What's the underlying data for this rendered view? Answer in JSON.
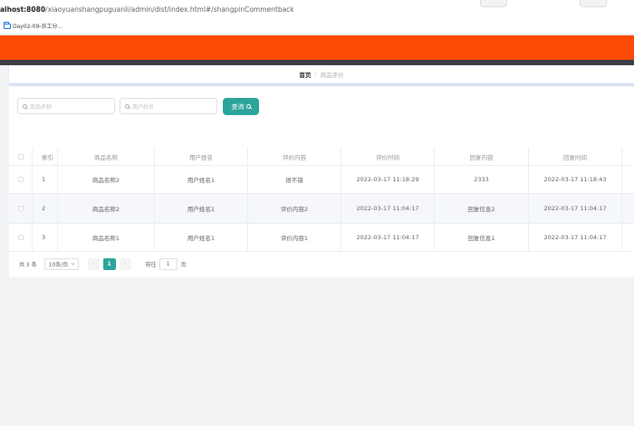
{
  "browser": {
    "url_host": "alhost:8080",
    "url_path": "/xiaoyuanshangpuguanli/admin/dist/index.html#/shangpinCommentback",
    "bookmark_label": "Day02-09-员工分..."
  },
  "colors": {
    "header": "#fc4a05",
    "accent": "#2ba59a"
  },
  "breadcrumb": {
    "home": "首页",
    "separator": "/",
    "current": "商品评价"
  },
  "search": {
    "product_placeholder": "商品名称",
    "user_placeholder": "用户姓名",
    "query_label": "查询"
  },
  "table": {
    "columns": [
      "索引",
      "商品名称",
      "用户姓名",
      "评价内容",
      "评价时间",
      "回复内容",
      "回复时间"
    ],
    "rows": [
      {
        "index": "1",
        "product": "商品名称2",
        "user": "用户姓名1",
        "content": "很不错",
        "time": "2022-03-17 11:18:29",
        "reply": "2333",
        "reply_time": "2022-03-17 11:18:43"
      },
      {
        "index": "2",
        "product": "商品名称2",
        "user": "用户姓名1",
        "content": "评价内容2",
        "time": "2022-03-17 11:04:17",
        "reply": "回复信息2",
        "reply_time": "2022-03-17 11:04:17"
      },
      {
        "index": "3",
        "product": "商品名称1",
        "user": "用户姓名1",
        "content": "评价内容1",
        "time": "2022-03-17 11:04:17",
        "reply": "回复信息1",
        "reply_time": "2022-03-17 11:04:17"
      }
    ]
  },
  "pagination": {
    "total": "共 3 条",
    "page_size": "10条/页",
    "prev": "‹",
    "current": "1",
    "next": "›",
    "goto_label": "前往",
    "goto_value": "1",
    "page_suffix": "页"
  }
}
